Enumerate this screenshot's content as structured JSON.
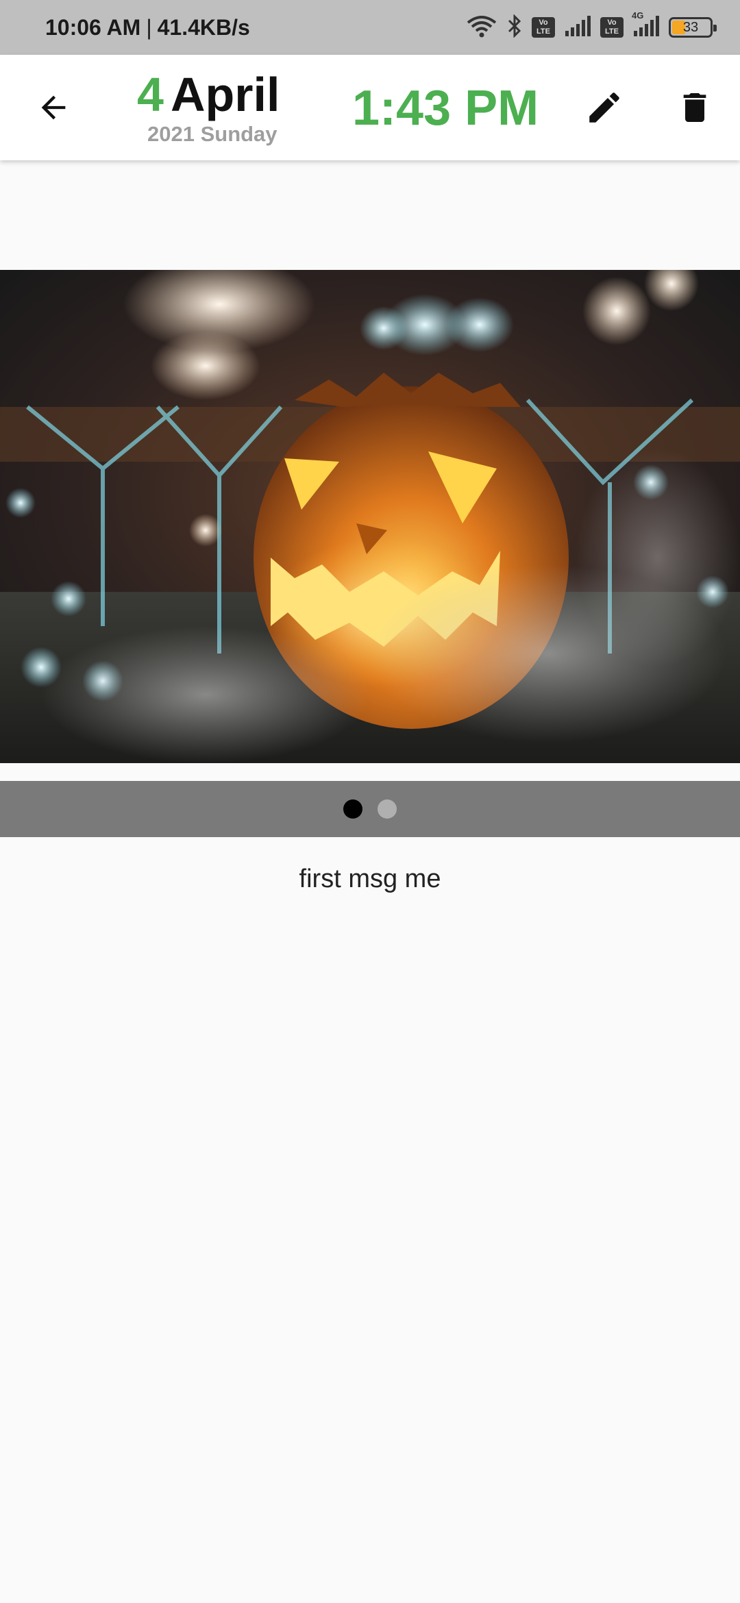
{
  "status_bar": {
    "time": "10:06 AM",
    "separator": "|",
    "speed": "41.4KB/s",
    "volte1_top": "Vo",
    "volte1_bottom": "LTE",
    "volte2_top": "Vo",
    "volte2_bottom": "LTE",
    "network_type": "4G",
    "battery": "33"
  },
  "header": {
    "day": "4",
    "month": "April",
    "year_weekday": "2021 Sunday",
    "time": "1:43 PM",
    "icons": [
      "back-arrow-icon",
      "edit-pencil-icon",
      "trash-icon"
    ]
  },
  "gallery": {
    "image": "halloween-pumpkin-photo",
    "page_count": 2,
    "current_page": 1
  },
  "note": {
    "text": "first msg me"
  },
  "colors": {
    "accent": "#4caf50",
    "status_bar_bg": "#bfbfbf",
    "pager_bg": "#7a7a7a",
    "page_bg": "#fafafa"
  }
}
